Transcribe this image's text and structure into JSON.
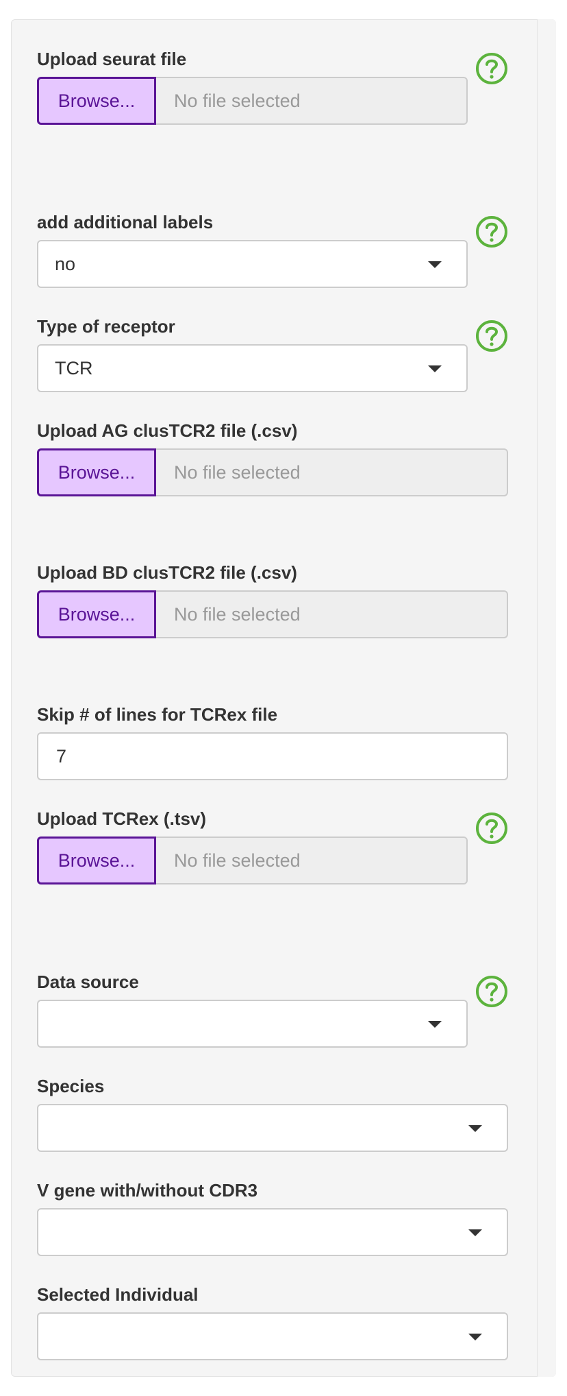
{
  "colors": {
    "accent_purple": "#5a1496",
    "browse_bg": "#e6c7ff",
    "help_green": "#5cb33d",
    "panel_bg": "#f5f5f5"
  },
  "icons": {
    "help": "question-circle-icon",
    "dropdown": "caret-down-icon"
  },
  "form": {
    "seurat": {
      "label": "Upload seurat file",
      "browse": "Browse...",
      "status": "No file selected"
    },
    "additional_labels": {
      "label": "add additional labels",
      "value": "no"
    },
    "receptor": {
      "label": "Type of receptor",
      "value": "TCR"
    },
    "ag_clustcr": {
      "label": "Upload AG clusTCR2 file (.csv)",
      "browse": "Browse...",
      "status": "No file selected"
    },
    "bd_clustcr": {
      "label": "Upload BD clusTCR2 file (.csv)",
      "browse": "Browse...",
      "status": "No file selected"
    },
    "skip_lines": {
      "label": "Skip # of lines for TCRex file",
      "value": "7"
    },
    "tcrex": {
      "label": "Upload TCRex (.tsv)",
      "browse": "Browse...",
      "status": "No file selected"
    },
    "data_source": {
      "label": "Data source",
      "value": ""
    },
    "species": {
      "label": "Species",
      "value": ""
    },
    "v_gene": {
      "label": "V gene with/without CDR3",
      "value": ""
    },
    "individual": {
      "label": "Selected Individual",
      "value": ""
    }
  }
}
